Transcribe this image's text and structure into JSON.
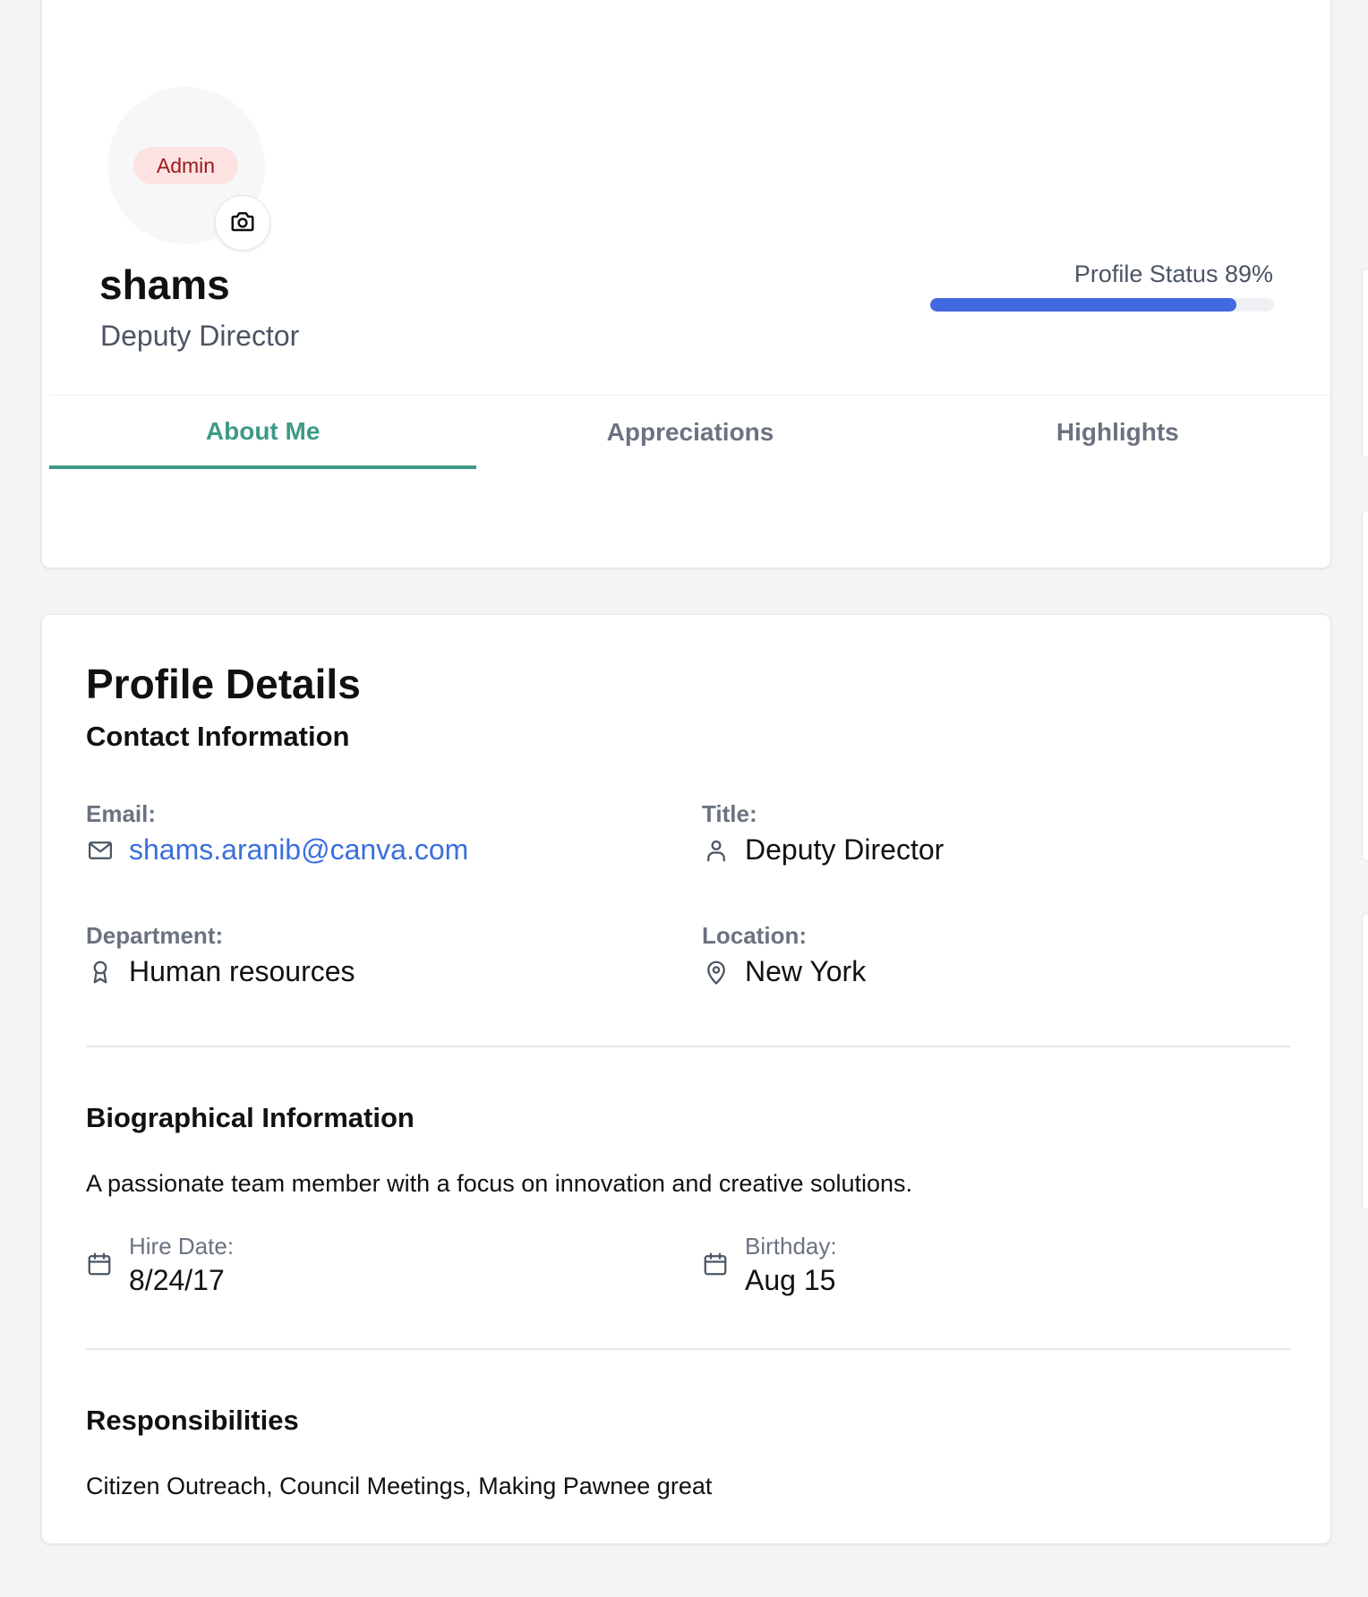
{
  "profile": {
    "role_badge": "Admin",
    "name": "shams",
    "job_title": "Deputy Director",
    "status_label": "Profile Status 89%",
    "status_percent": 89,
    "tabs": [
      {
        "label": "About Me",
        "active": true
      },
      {
        "label": "Appreciations",
        "active": false
      },
      {
        "label": "Highlights",
        "active": false
      }
    ]
  },
  "details": {
    "title": "Profile Details",
    "contact": {
      "heading": "Contact Information",
      "email_label": "Email:",
      "email_value": "shams.aranib@canva.com",
      "title_label": "Title:",
      "title_value": "Deputy Director",
      "department_label": "Department:",
      "department_value": "Human resources",
      "location_label": "Location:",
      "location_value": "New York"
    },
    "bio": {
      "heading": "Biographical Information",
      "text": "A passionate team member with a focus on innovation and creative solutions.",
      "hire_label": "Hire Date:",
      "hire_value": "8/24/17",
      "birthday_label": "Birthday:",
      "birthday_value": "Aug 15"
    },
    "responsibilities": {
      "heading": "Responsibilities",
      "text": "Citizen Outreach, Council Meetings, Making Pawnee great"
    }
  },
  "colors": {
    "accent": "#3d9a86",
    "progress": "#4169e1",
    "link": "#3b6fde",
    "badge_bg": "#fde2e2",
    "badge_text": "#991b1b"
  },
  "icons": [
    "camera-icon",
    "mail-icon",
    "user-icon",
    "award-icon",
    "map-pin-icon",
    "calendar-icon"
  ]
}
